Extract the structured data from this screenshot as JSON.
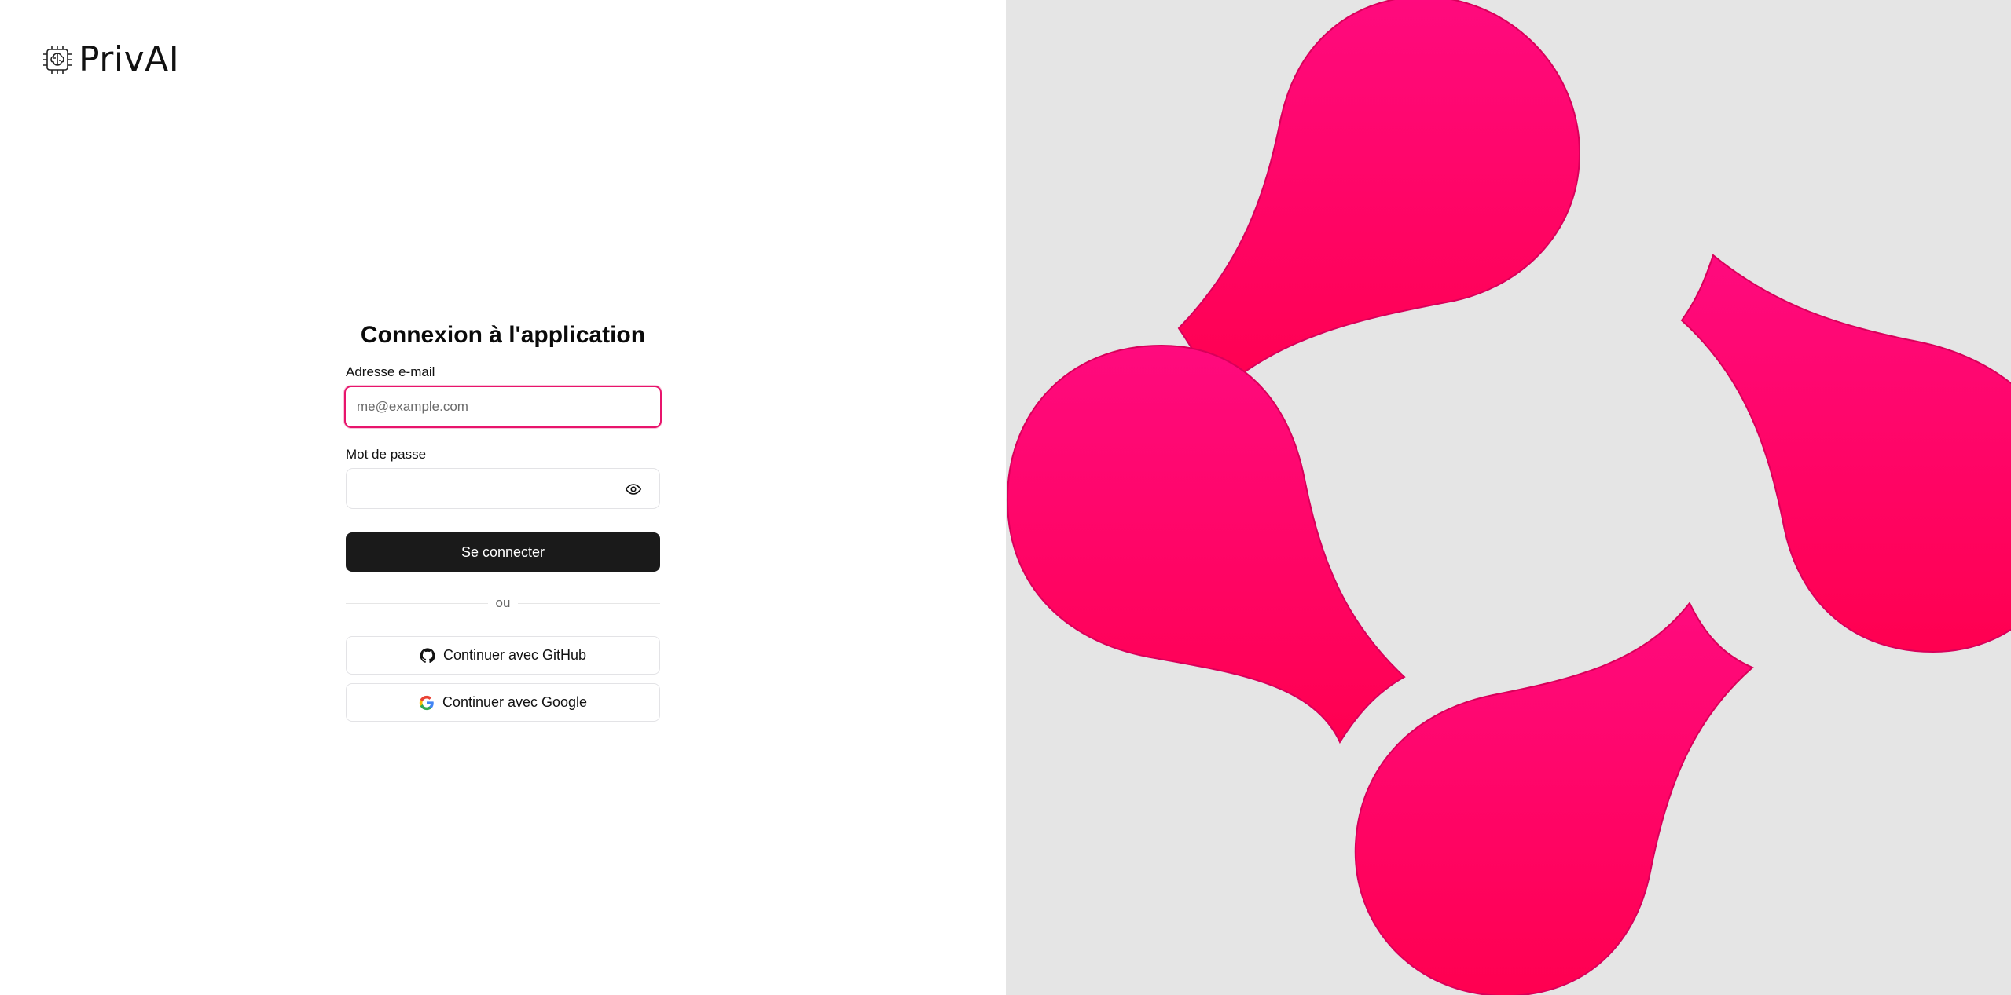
{
  "brand": {
    "name": "PrivAI",
    "icon": "chip-brain-icon"
  },
  "login": {
    "title": "Connexion à l'application",
    "email_label": "Adresse e-mail",
    "email_placeholder": "me@example.com",
    "email_value": "",
    "password_label": "Mot de passe",
    "password_value": "",
    "password_toggle_icon": "eye-icon",
    "submit_label": "Se connecter",
    "divider_text": "ou",
    "github_label": "Continuer avec GitHub",
    "github_icon": "github-icon",
    "google_label": "Continuer avec Google",
    "google_icon": "google-icon"
  },
  "colors": {
    "accent": "#e8146c",
    "primary_button": "#1a1a1a",
    "right_background": "#e5e5e5",
    "petal_top": "#ff0a7e",
    "petal_bottom": "#ff0050"
  },
  "illustration": {
    "name": "four-petal-logo-art"
  }
}
